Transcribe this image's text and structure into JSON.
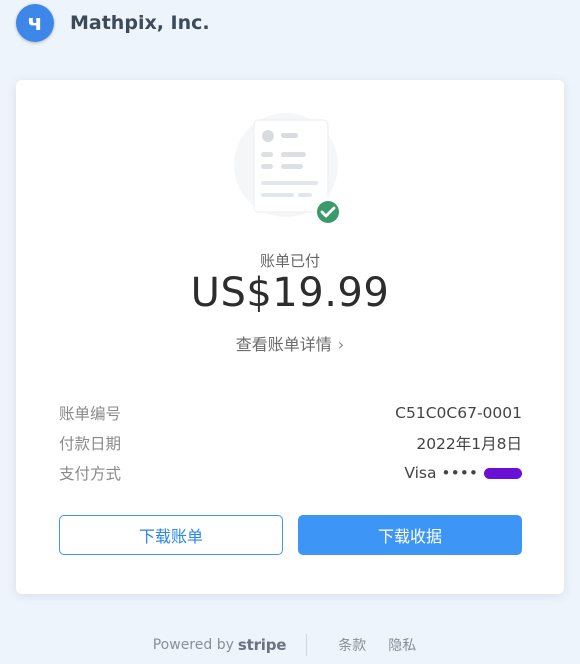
{
  "header": {
    "company": "Mathpix, Inc.",
    "logo_glyph": "ч"
  },
  "card": {
    "status": "账单已付",
    "amount": "US$19.99",
    "details_link": "查看账单详情",
    "rows": [
      {
        "label": "账单编号",
        "value": "C51C0C67-0001"
      },
      {
        "label": "付款日期",
        "value": "2022年1月8日"
      },
      {
        "label": "支付方式",
        "value": "Visa ••••"
      }
    ],
    "download_invoice": "下载账单",
    "download_receipt": "下载收据"
  },
  "footer": {
    "powered_by": "Powered by",
    "stripe": "stripe",
    "terms": "条款",
    "privacy": "隐私"
  },
  "colors": {
    "accent": "#3d95f5",
    "success": "#3a9a6b",
    "redaction": "#6a0fd6"
  }
}
